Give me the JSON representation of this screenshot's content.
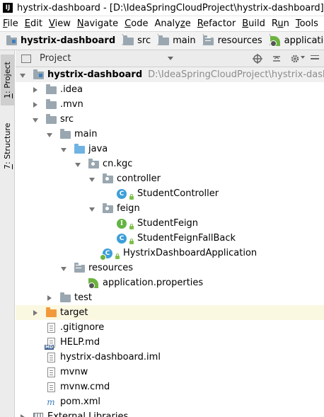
{
  "window": {
    "title": "hystrix-dashboard - [D:\\IdeaSpringCloudProject\\hystrix-dashboard] - [hystrix",
    "logo_text": "IJ"
  },
  "menu": {
    "items": [
      {
        "mnemonic": "F",
        "rest": "ile"
      },
      {
        "mnemonic": "E",
        "rest": "dit"
      },
      {
        "mnemonic": "V",
        "rest": "iew"
      },
      {
        "mnemonic": "N",
        "rest": "avigate"
      },
      {
        "mnemonic": "C",
        "rest": "ode"
      },
      {
        "prefix": "Analy",
        "mnemonic": "z",
        "rest": "e"
      },
      {
        "mnemonic": "R",
        "rest": "efactor"
      },
      {
        "mnemonic": "B",
        "rest": "uild"
      },
      {
        "prefix": "R",
        "mnemonic": "u",
        "rest": "n"
      },
      {
        "mnemonic": "T",
        "rest": "ools"
      }
    ]
  },
  "breadcrumb": {
    "items": [
      "hystrix-dashboard",
      "src",
      "main",
      "resources",
      "application.pro"
    ]
  },
  "sidebar": {
    "project_tab": {
      "num": "1",
      "text": ": Project"
    },
    "structure_tab": {
      "num": "7",
      "text": ": Structure"
    }
  },
  "panel": {
    "title": "Project"
  },
  "tree": {
    "root_label": "hystrix-dashboard",
    "root_path": "D:\\IdeaSpringCloudProject\\hystrix-dashboard",
    "idea": ".idea",
    "mvn": ".mvn",
    "src": "src",
    "main": "main",
    "java": "java",
    "pkg": "cn.kgc",
    "controller": "controller",
    "student_controller": "StudentController",
    "feign": "feign",
    "student_feign": "StudentFeign",
    "student_feign_fallback": "StudentFeignFallBack",
    "app_class": "HystrixDashboardApplication",
    "resources": "resources",
    "app_props": "application.properties",
    "test": "test",
    "target": "target",
    "gitignore": ".gitignore",
    "help": "HELP.md",
    "iml": "hystrix-dashboard.iml",
    "mvnw": "mvnw",
    "mvnw_cmd": "mvnw.cmd",
    "pom": "pom.xml",
    "ext_libs": "External Libraries"
  },
  "icons": {
    "class_badge": "C",
    "interface_badge": "I",
    "md_badge": "MD",
    "maven_badge": "m"
  },
  "colors": {
    "folder": "#9aa7b0",
    "source_folder": "#6fb3e3",
    "excluded_folder": "#f29a3b",
    "class_icon": "#3d9fd9",
    "interface_icon": "#62b543",
    "spring": "#6db33f"
  }
}
